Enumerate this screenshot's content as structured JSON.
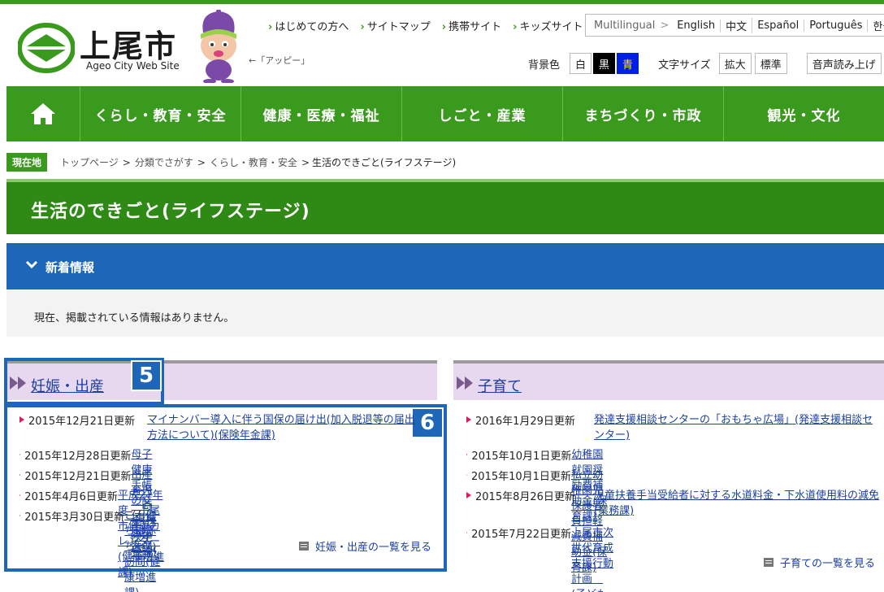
{
  "header": {
    "logo_text": "上尾市",
    "logo_sub": "Ageo City Web Site",
    "mascot_note": "←「アッピー」",
    "links": [
      "はじめての方へ",
      "サイトマップ",
      "携帯サイト",
      "キッズサイト"
    ],
    "lang_label": "Multilingual",
    "lang_sep": ">",
    "languages": [
      "English",
      "中文",
      "Español",
      "Português",
      "한국어"
    ],
    "bg_label": "背景色",
    "bg_options": [
      "白",
      "黒",
      "青"
    ],
    "size_label": "文字サイズ",
    "size_options": [
      "拡大",
      "標準"
    ],
    "speech": "音声読み上げ"
  },
  "nav": [
    "くらし・教育・安全",
    "健康・医療・福祉",
    "しごと・産業",
    "まちづくり・市政",
    "観光・文化"
  ],
  "breadcrumb": {
    "tag": "現在地",
    "links": [
      "トップページ",
      "分類でさがす",
      "くらし・教育・安全"
    ],
    "current": "生活のできごと(ライフステージ)"
  },
  "page_title": "生活のできごと(ライフステージ)",
  "news": {
    "label": "新着情報",
    "empty": "現在、掲載されている情報はありません。"
  },
  "left_panel": {
    "title": "妊娠・出産",
    "badge": "5",
    "list_badge": "6",
    "items": [
      {
        "date": "2015年12月21日更新",
        "text": "マイナンバー導入に伴う国保の届け出(加入脱退等の届出方法について)(保険年金課)"
      },
      {
        "date": "2015年12月28日更新",
        "text": "母子健康手帳の交付(健康増進課)"
      },
      {
        "date": "2015年12月21日更新",
        "text": "出産育児一時金(保険年金課)"
      },
      {
        "date": "2015年4月6日更新",
        "text": "平成27年度　上尾市健康カレンダー(健康増進課)"
      },
      {
        "date": "2015年3月30日更新",
        "text": "こんにちは赤ちゃん訪問(健康増進課)"
      }
    ],
    "more": "妊娠・出産の一覧を見る"
  },
  "right_panel": {
    "title": "子育て",
    "items": [
      {
        "date": "2016年1月29日更新",
        "text": "発達支援相談センターの「おもちゃ広場」(発達支援相談センター)"
      },
      {
        "date": "2015年10月1日更新",
        "text": "幼稚園就園奨励費補助金(保育課)"
      },
      {
        "date": "2015年10月1日更新",
        "text": "私立幼稚園児保護者負担軽減費補助金(保育課)"
      },
      {
        "date": "2015年8月26日更新",
        "text": "児童扶養手当受給者に対する水道料金・下水道使用料の減免(業務課)"
      },
      {
        "date": "2015年7月22日更新",
        "text": "上尾市次世代育成支援行動計画　(子ども支援課)"
      }
    ],
    "more": "子育ての一覧を見る"
  },
  "colors": {
    "green": "#3a9a1e",
    "blue": "#1e66b8",
    "lavender": "#e8d8ef",
    "bullet": "#d81b60"
  }
}
